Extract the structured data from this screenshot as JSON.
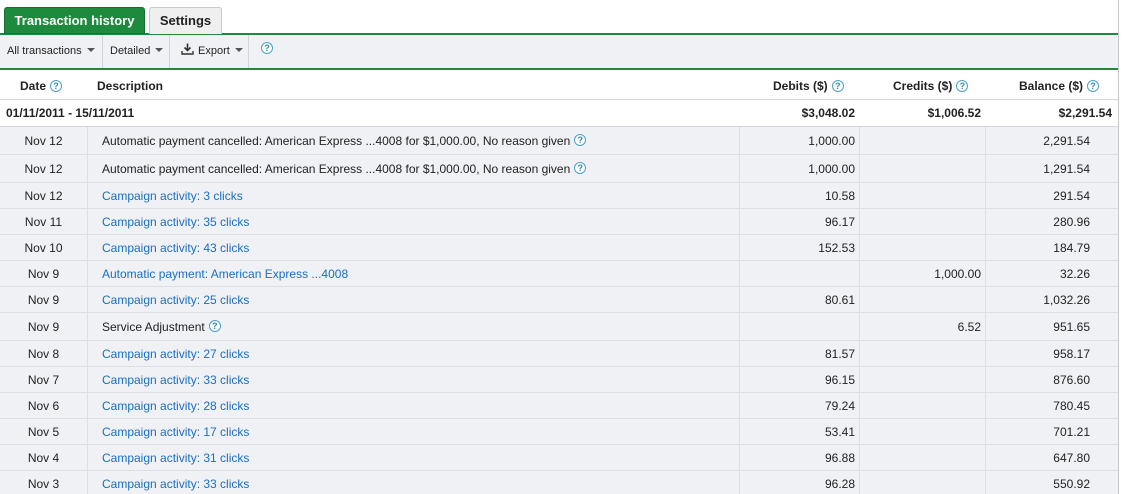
{
  "tabs": {
    "active": "Transaction history",
    "inactive": "Settings"
  },
  "toolbar": {
    "filter_label": "All transactions",
    "view_label": "Detailed",
    "export_label": "Export",
    "help_glyph": "?"
  },
  "table": {
    "headers": {
      "date": "Date",
      "description": "Description",
      "debits": "Debits ($)",
      "credits": "Credits ($)",
      "balance": "Balance ($)"
    },
    "range": {
      "label": "01/11/2011 - 15/11/2011",
      "debits": "$3,048.02",
      "credits": "$1,006.52",
      "balance": "$2,291.54"
    },
    "rows": [
      {
        "date": "Nov 12",
        "description": "Automatic payment cancelled: American Express ...4008 for $1,000.00, No reason given",
        "link": false,
        "help": true,
        "debit": "1,000.00",
        "credit": "",
        "balance": "2,291.54"
      },
      {
        "date": "Nov 12",
        "description": "Automatic payment cancelled: American Express ...4008 for $1,000.00, No reason given",
        "link": false,
        "help": true,
        "debit": "1,000.00",
        "credit": "",
        "balance": "1,291.54"
      },
      {
        "date": "Nov 12",
        "description": "Campaign activity: 3 clicks",
        "link": true,
        "help": false,
        "debit": "10.58",
        "credit": "",
        "balance": "291.54"
      },
      {
        "date": "Nov 11",
        "description": "Campaign activity: 35 clicks",
        "link": true,
        "help": false,
        "debit": "96.17",
        "credit": "",
        "balance": "280.96"
      },
      {
        "date": "Nov 10",
        "description": "Campaign activity: 43 clicks",
        "link": true,
        "help": false,
        "debit": "152.53",
        "credit": "",
        "balance": "184.79"
      },
      {
        "date": "Nov 9",
        "description": "Automatic payment: American Express ...4008",
        "link": true,
        "help": false,
        "debit": "",
        "credit": "1,000.00",
        "balance": "32.26"
      },
      {
        "date": "Nov 9",
        "description": "Campaign activity: 25 clicks",
        "link": true,
        "help": false,
        "debit": "80.61",
        "credit": "",
        "balance": "1,032.26"
      },
      {
        "date": "Nov 9",
        "description": "Service Adjustment",
        "link": false,
        "help": true,
        "debit": "",
        "credit": "6.52",
        "balance": "951.65"
      },
      {
        "date": "Nov 8",
        "description": "Campaign activity: 27 clicks",
        "link": true,
        "help": false,
        "debit": "81.57",
        "credit": "",
        "balance": "958.17"
      },
      {
        "date": "Nov 7",
        "description": "Campaign activity: 33 clicks",
        "link": true,
        "help": false,
        "debit": "96.15",
        "credit": "",
        "balance": "876.60"
      },
      {
        "date": "Nov 6",
        "description": "Campaign activity: 28 clicks",
        "link": true,
        "help": false,
        "debit": "79.24",
        "credit": "",
        "balance": "780.45"
      },
      {
        "date": "Nov 5",
        "description": "Campaign activity: 17 clicks",
        "link": true,
        "help": false,
        "debit": "53.41",
        "credit": "",
        "balance": "701.21"
      },
      {
        "date": "Nov 4",
        "description": "Campaign activity: 31 clicks",
        "link": true,
        "help": false,
        "debit": "96.88",
        "credit": "",
        "balance": "647.80"
      },
      {
        "date": "Nov 3",
        "description": "Campaign activity: 33 clicks",
        "link": true,
        "help": false,
        "debit": "96.28",
        "credit": "",
        "balance": "550.92"
      }
    ]
  },
  "colors": {
    "accent_green": "#1e8a3e",
    "link_blue": "#1a6ec0",
    "row_bg": "#f0f1f5",
    "help_blue": "#2e8bb8"
  }
}
